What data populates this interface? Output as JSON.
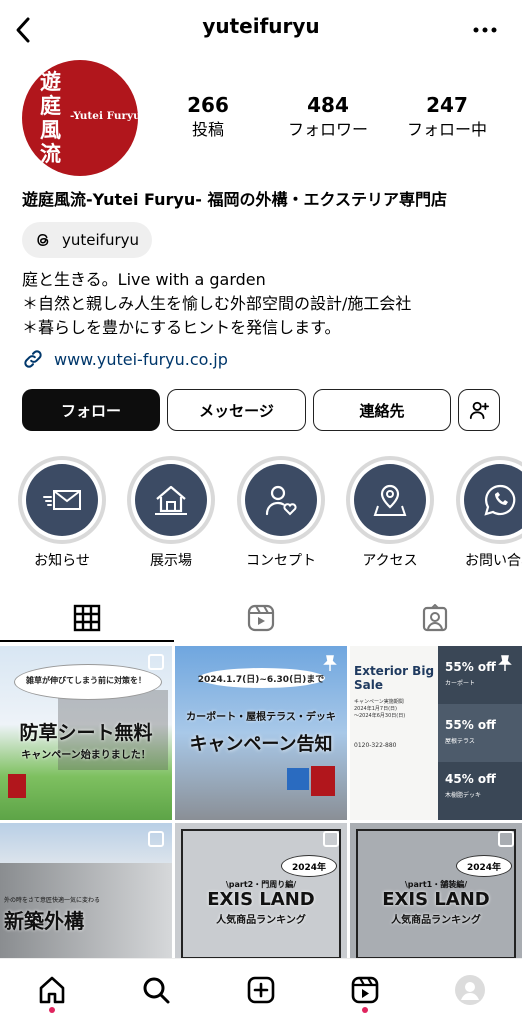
{
  "header": {
    "username": "yuteifuryu"
  },
  "avatar": {
    "kanji": "遊庭風流",
    "latin": "-Yutei Furyu-"
  },
  "stats": [
    {
      "value": "266",
      "label": "投稿"
    },
    {
      "value": "484",
      "label": "フォロワー"
    },
    {
      "value": "247",
      "label": "フォロー中"
    }
  ],
  "profile": {
    "display_name": "遊庭風流-Yutei Furyu- 福岡の外構・エクステリア専門店",
    "threads_handle": "yuteifuryu",
    "bio": [
      "庭と生きる。Live with a garden",
      "＊自然と親しみ人生を愉しむ外部空間の設計/施工会社",
      "＊暮らしを豊かにするヒントを発信します。"
    ],
    "link": "www.yutei-furyu.co.jp"
  },
  "buttons": {
    "follow": "フォロー",
    "message": "メッセージ",
    "contact": "連絡先"
  },
  "highlights": [
    {
      "label": "お知らせ",
      "icon": "mail-icon"
    },
    {
      "label": "展示場",
      "icon": "house-icon"
    },
    {
      "label": "コンセプト",
      "icon": "person-heart-icon"
    },
    {
      "label": "アクセス",
      "icon": "map-pin-icon"
    },
    {
      "label": "お問い合わ",
      "icon": "phone-icon"
    }
  ],
  "posts": [
    {
      "bubble": "雑草が伸びてしまう前に対策を！",
      "title": "防草シート無料",
      "subtitle": "キャンペーン始まりました！"
    },
    {
      "date": "2024.1.7(日)~6.30(日)まで",
      "subtitle": "カーポート・屋根テラス・デッキ",
      "title": "キャンペーン告知"
    },
    {
      "title": "Exterior Big Sale",
      "subtitle": "キャンペーン実施期間",
      "period": "2024年1月7日(日)",
      "period_end": "〜2024年6月30日(日)",
      "phone": "0120-322-880",
      "offers": [
        {
          "pct": "55% off",
          "item": "カーポート"
        },
        {
          "pct": "55% off",
          "item": "屋根テラス"
        },
        {
          "pct": "45% off",
          "item": "木樹脂デッキ"
        }
      ]
    },
    {
      "small": "外の時をさて意匠快適一気に変わる",
      "title": "新築外構"
    },
    {
      "year": "2024年",
      "part": "\\part2・門周り編/",
      "title": "EXIS LAND",
      "subtitle": "人気商品ランキング"
    },
    {
      "year": "2024年",
      "part": "\\part1・舗装編/",
      "title": "EXIS LAND",
      "subtitle": "人気商品ランキング"
    }
  ],
  "colors": {
    "brand_red": "#b1161c",
    "highlight_bg": "#3c4b64",
    "link": "#00376b",
    "notification": "#e0245e"
  }
}
